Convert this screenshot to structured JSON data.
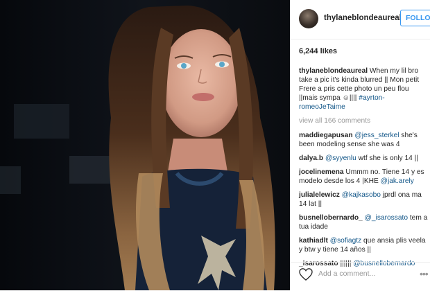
{
  "post": {
    "username": "thylaneblondeaureal",
    "follow_label": "FOLLOW",
    "likes": "6,244 likes",
    "caption": {
      "user": "thylaneblondeaureal",
      "text": "When my lil bro take a pic it's kinda blurred || Mon petit Frere a pris cette photo un peu flou ||mais sympa ☺|||| ",
      "tag": "#ayrton-romeoJeTaime"
    },
    "view_all": "view all 166 comments",
    "comments": [
      {
        "user": "maddiegapusan",
        "mention": "@jess_sterkel",
        "text": " she's been modeling sense she was 4"
      },
      {
        "user": "dalya.b",
        "mention": "@syyenlu",
        "text": " wtf she is only 14 ||"
      },
      {
        "user": "jocelinemena",
        "pre": "Ummm no. Tiene 14 y es modelo desde los 4 |KHE ",
        "mention": "@jak.arely",
        "text": ""
      },
      {
        "user": "julialelewicz",
        "mention": "@kajkasobo",
        "text": " jprdl ona ma 14 lat ||"
      },
      {
        "user": "busnellobernardo_",
        "mention": "@_isarossato",
        "text": " tem a tua idade"
      },
      {
        "user": "kathiadlt",
        "mention": "@sofiagtz",
        "text": "  que ansia plis veela y btw y tiene 14 años ||"
      },
      {
        "user": "_isarossato",
        "pre": "|||||| ",
        "mention": "@busnellobernardo",
        "text": ""
      }
    ],
    "add_comment_placeholder": "Add a comment..."
  },
  "icons": {
    "like": "heart-icon",
    "more": "more-options-icon"
  },
  "colors": {
    "accent": "#3897f0",
    "mention": "#125688",
    "muted": "#999999"
  }
}
